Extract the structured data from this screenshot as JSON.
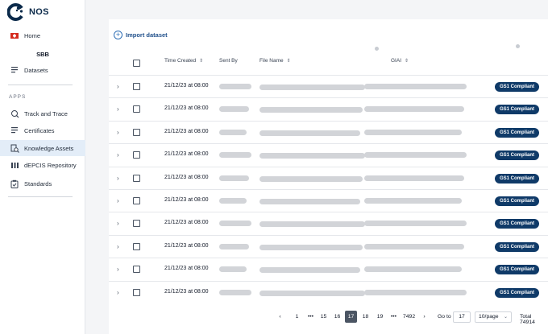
{
  "app": {
    "name": "NOS"
  },
  "sidebar": {
    "home": "Home",
    "org": "SBB",
    "datasets": "Datasets",
    "apps_title": "APPS",
    "items": [
      {
        "label": "Track and Trace"
      },
      {
        "label": "Certificates"
      },
      {
        "label": "Knowledge Assets",
        "active": true
      },
      {
        "label": "dEPCIS Repository"
      },
      {
        "label": "Standards"
      }
    ]
  },
  "main": {
    "import_label": "Import dataset",
    "columns": {
      "time": "Time Created",
      "sent_by": "Sent By",
      "file_name": "File Name",
      "giai": "GIAI"
    },
    "rows": [
      {
        "time": "21/12/23 at 08:00",
        "status": "GS1 Compliant"
      },
      {
        "time": "21/12/23 at 08:00",
        "status": "GS1 Compliant"
      },
      {
        "time": "21/12/23 at 08:00",
        "status": "GS1 Compliant"
      },
      {
        "time": "21/12/23 at 08:00",
        "status": "GS1 Compliant"
      },
      {
        "time": "21/12/23 at 08:00",
        "status": "GS1 Compliant"
      },
      {
        "time": "21/12/23 at 08:00",
        "status": "GS1 Compliant"
      },
      {
        "time": "21/12/23 at 08:00",
        "status": "GS1 Compliant"
      },
      {
        "time": "21/12/23 at 08:00",
        "status": "GS1 Compliant"
      },
      {
        "time": "21/12/23 at 08:00",
        "status": "GS1 Compliant"
      },
      {
        "time": "21/12/23 at 08:00",
        "status": "GS1 Compliant"
      }
    ]
  },
  "pagination": {
    "prev": "‹",
    "pages": [
      "1",
      "•••",
      "15",
      "16",
      "17",
      "18",
      "19",
      "•••",
      "7492"
    ],
    "active": "17",
    "next": "›",
    "goto_label": "Go to",
    "goto_value": "17",
    "page_size": "10/page",
    "total": "Total 74914"
  },
  "colors": {
    "brand": "#0b2a4a",
    "badge": "#0f3a68",
    "active_nav": "#e3edf8"
  }
}
